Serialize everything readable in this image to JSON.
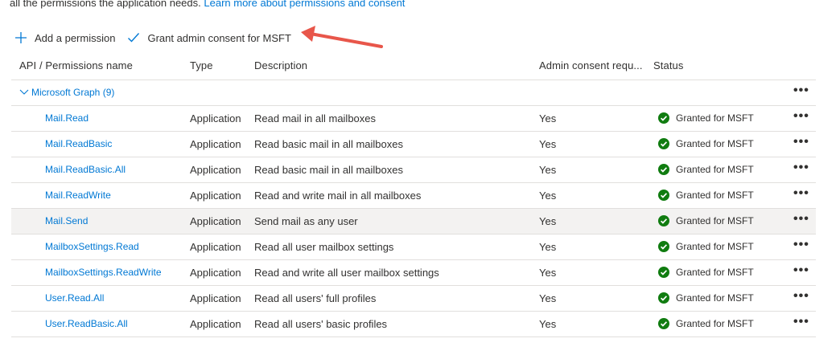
{
  "intro": {
    "text": "all the permissions the application needs. ",
    "link": "Learn more about permissions and consent"
  },
  "toolbar": {
    "add_label": "Add a permission",
    "grant_label": "Grant admin consent for MSFT"
  },
  "table": {
    "headers": {
      "name": "API / Permissions name",
      "type": "Type",
      "description": "Description",
      "admin": "Admin consent requ...",
      "status": "Status"
    },
    "group": {
      "label": "Microsoft Graph (9)"
    },
    "more_glyph": "•••",
    "rows": [
      {
        "name": "Mail.Read",
        "type": "Application",
        "description": "Read mail in all mailboxes",
        "admin": "Yes",
        "status": "Granted for MSFT"
      },
      {
        "name": "Mail.ReadBasic",
        "type": "Application",
        "description": "Read basic mail in all mailboxes",
        "admin": "Yes",
        "status": "Granted for MSFT"
      },
      {
        "name": "Mail.ReadBasic.All",
        "type": "Application",
        "description": "Read basic mail in all mailboxes",
        "admin": "Yes",
        "status": "Granted for MSFT"
      },
      {
        "name": "Mail.ReadWrite",
        "type": "Application",
        "description": "Read and write mail in all mailboxes",
        "admin": "Yes",
        "status": "Granted for MSFT"
      },
      {
        "name": "Mail.Send",
        "type": "Application",
        "description": "Send mail as any user",
        "admin": "Yes",
        "status": "Granted for MSFT",
        "selected": true
      },
      {
        "name": "MailboxSettings.Read",
        "type": "Application",
        "description": "Read all user mailbox settings",
        "admin": "Yes",
        "status": "Granted for MSFT"
      },
      {
        "name": "MailboxSettings.ReadWrite",
        "type": "Application",
        "description": "Read and write all user mailbox settings",
        "admin": "Yes",
        "status": "Granted for MSFT"
      },
      {
        "name": "User.Read.All",
        "type": "Application",
        "description": "Read all users' full profiles",
        "admin": "Yes",
        "status": "Granted for MSFT"
      },
      {
        "name": "User.ReadBasic.All",
        "type": "Application",
        "description": "Read all users' basic profiles",
        "admin": "Yes",
        "status": "Granted for MSFT"
      }
    ]
  },
  "colors": {
    "link": "#0078d4",
    "success": "#107c10",
    "annotation_arrow": "#e8564a"
  }
}
